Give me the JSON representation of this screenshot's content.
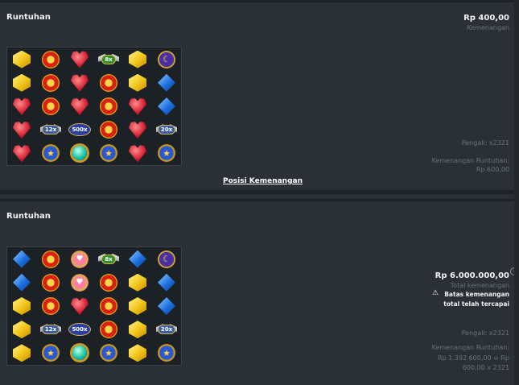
{
  "panel1": {
    "title": "Runtuhan",
    "amount": "Rp 400,00",
    "amount_label": "Kemenangan",
    "multiplier_text": "Pengali: x2321",
    "tumble_label": "Kemenangan Runtuhan:",
    "tumble_value": "Rp 600,00",
    "link": "Posisi Kemenangan",
    "grid": [
      [
        "gem-yellow",
        "sun-badge",
        "gem-red",
        "mult-green:8x",
        "gem-yellow",
        "moon-badge"
      ],
      [
        "gem-yellow",
        "sun-badge",
        "gem-red",
        "sun-badge",
        "gem-yellow",
        "gem-blue"
      ],
      [
        "gem-red",
        "sun-badge",
        "gem-red",
        "sun-badge",
        "gem-red",
        "gem-blue"
      ],
      [
        "gem-red",
        "mult:12x",
        "mult-big:500x",
        "sun-badge",
        "gem-red",
        "mult:20x"
      ],
      [
        "gem-red",
        "star-badge",
        "gem-teal",
        "star-badge",
        "gem-red",
        "star-badge"
      ]
    ]
  },
  "panel2": {
    "title": "Runtuhan",
    "amount": "Rp 6.000.000,00",
    "amount_label": "Total kemenangan",
    "warning_line1": "Batas kemenangan",
    "warning_line2": "total telah tercapai",
    "multiplier_text": "Pengali: x2321",
    "tumble_label": "Kemenangan Runtuhan:",
    "tumble_value1": "Rp 1.392.600,00 = Rp",
    "tumble_value2": "600,00 x 2321",
    "grid": [
      [
        "gem-blue",
        "sun-badge",
        "heart-badge",
        "mult-green:8x",
        "gem-blue",
        "moon-badge"
      ],
      [
        "gem-blue",
        "sun-badge",
        "heart-badge",
        "sun-badge",
        "gem-yellow",
        "gem-blue"
      ],
      [
        "gem-yellow",
        "sun-badge",
        "gem-red",
        "sun-badge",
        "gem-yellow",
        "gem-blue"
      ],
      [
        "gem-yellow",
        "mult:12x",
        "mult-big:500x",
        "sun-badge",
        "gem-yellow",
        "mult:20x"
      ],
      [
        "gem-yellow",
        "star-badge",
        "gem-teal",
        "star-badge",
        "gem-yellow",
        "star-badge"
      ]
    ]
  },
  "icons": {
    "warning": "warning-icon",
    "info": "info-icon"
  },
  "colors": {
    "background": "#2a3035",
    "text": "#f2f3f4",
    "muted": "#6c7378"
  }
}
